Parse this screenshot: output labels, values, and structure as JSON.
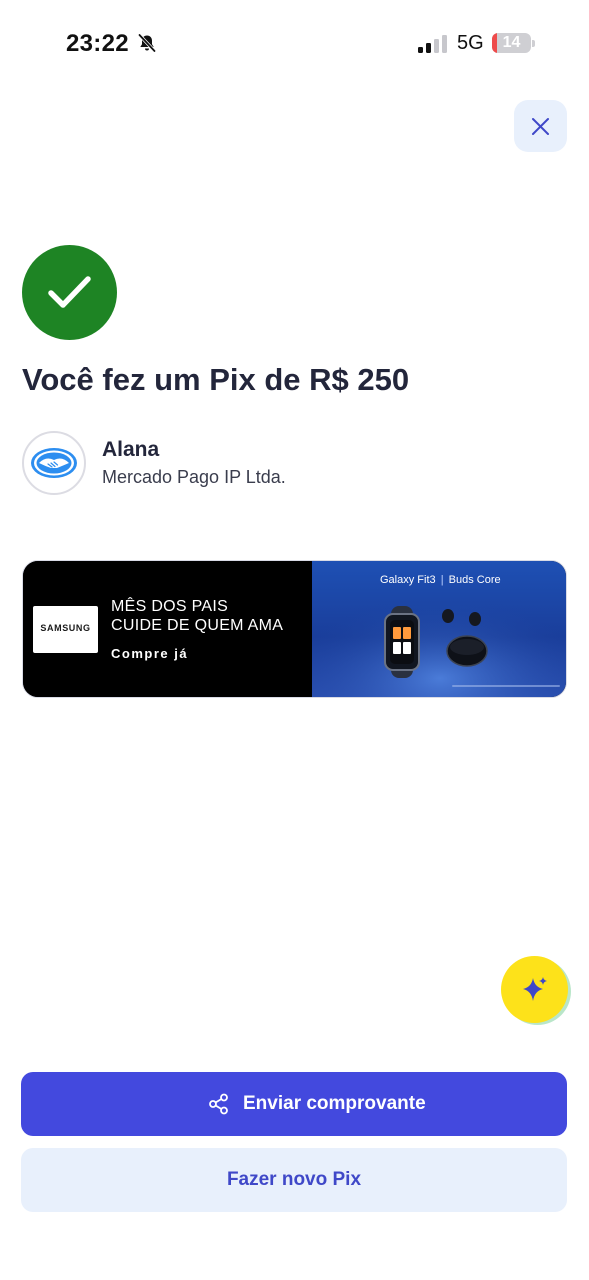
{
  "status_bar": {
    "time": "23:22",
    "network": "5G",
    "battery_level": "14",
    "battery_percent": 14,
    "silent_icon": "bell-slash-icon",
    "signal_icon": "signal-bars-icon"
  },
  "header": {
    "close_icon": "close-icon"
  },
  "confirmation": {
    "status_icon": "checkmark-icon",
    "headline": "Você fez um Pix de R$ 250",
    "recipient": {
      "name": "Alana",
      "institution": "Mercado Pago IP Ltda.",
      "avatar_icon": "handshake-logo-icon"
    }
  },
  "ad_banner": {
    "brand": "SAMSUNG",
    "line1": "MÊS DOS PAIS",
    "line2": "CUIDE DE QUEM AMA",
    "cta": "Compre já",
    "product1": "Galaxy Fit3",
    "separator": "|",
    "product2": "Buds Core"
  },
  "assistant": {
    "icon": "sparkle-icon"
  },
  "actions": {
    "share_icon": "share-icon",
    "send_receipt_label": "Enviar comprovante",
    "new_pix_label": "Fazer novo Pix"
  },
  "colors": {
    "primary": "#4349de",
    "success": "#1e8424",
    "surface_light": "#e8f0fc",
    "assistant_yellow": "#fde21a",
    "battery_low": "#ee4b4b"
  }
}
